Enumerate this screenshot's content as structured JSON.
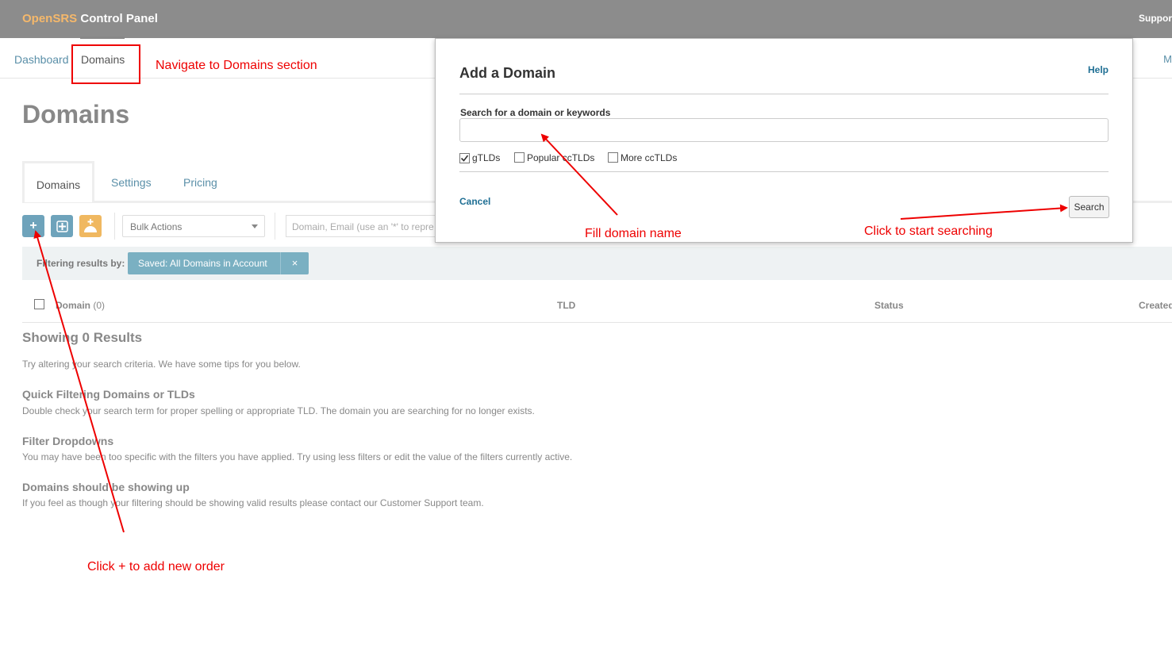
{
  "header": {
    "brand_part1": "OpenSRS",
    "brand_part2": " Control Panel",
    "support_label": "Suppor"
  },
  "nav": {
    "dashboard": "Dashboard",
    "domains": "Domains",
    "right_item": "M"
  },
  "page": {
    "title": "Domains"
  },
  "tabs": [
    "Domains",
    "Settings",
    "Pricing"
  ],
  "toolbar": {
    "add_label": "+",
    "bulk_actions": "Bulk Actions",
    "search_placeholder": "Domain, Email (use an '*' to repre"
  },
  "filter": {
    "label": "Filtering results by:",
    "tag": "Saved: All Domains in Account",
    "remove": "×"
  },
  "table": {
    "col_domain": "Domain",
    "col_domain_count": "(0)",
    "col_tld": "TLD",
    "col_status": "Status",
    "col_created": "Created"
  },
  "empty": {
    "title": "Showing 0 Results",
    "intro": "Try altering your search criteria. We have some tips for you below.",
    "tip1_title": "Quick Filtering Domains or TLDs",
    "tip1_text": "Double check your search term for proper spelling or appropriate TLD. The domain you are searching for no longer exists.",
    "tip2_title": "Filter Dropdowns",
    "tip2_text": "You may have been too specific with the filters you have applied. Try using less filters or edit the value of the filters currently active.",
    "tip3_title": "Domains should be showing up",
    "tip3_text": "If you feel as though your filtering should be showing valid results please contact our Customer Support team."
  },
  "modal": {
    "title": "Add a Domain",
    "help": "Help",
    "search_label": "Search for a domain or keywords",
    "search_value": "",
    "options": [
      {
        "label": "gTLDs",
        "checked": true
      },
      {
        "label": "Popular ccTLDs",
        "checked": false
      },
      {
        "label": "More ccTLDs",
        "checked": false
      }
    ],
    "cancel": "Cancel",
    "search_button": "Search"
  },
  "annotations": {
    "nav_hint": "Navigate to Domains section",
    "fill_hint": "Fill domain name",
    "search_hint": "Click to start searching",
    "add_hint": "Click + to add new order"
  },
  "colors": {
    "topbar": "#8c8c8c",
    "brand_accent": "#f5b86b",
    "link": "#5a8fa8",
    "annotation": "#e00000",
    "filter_tag": "#7ab0c2"
  }
}
